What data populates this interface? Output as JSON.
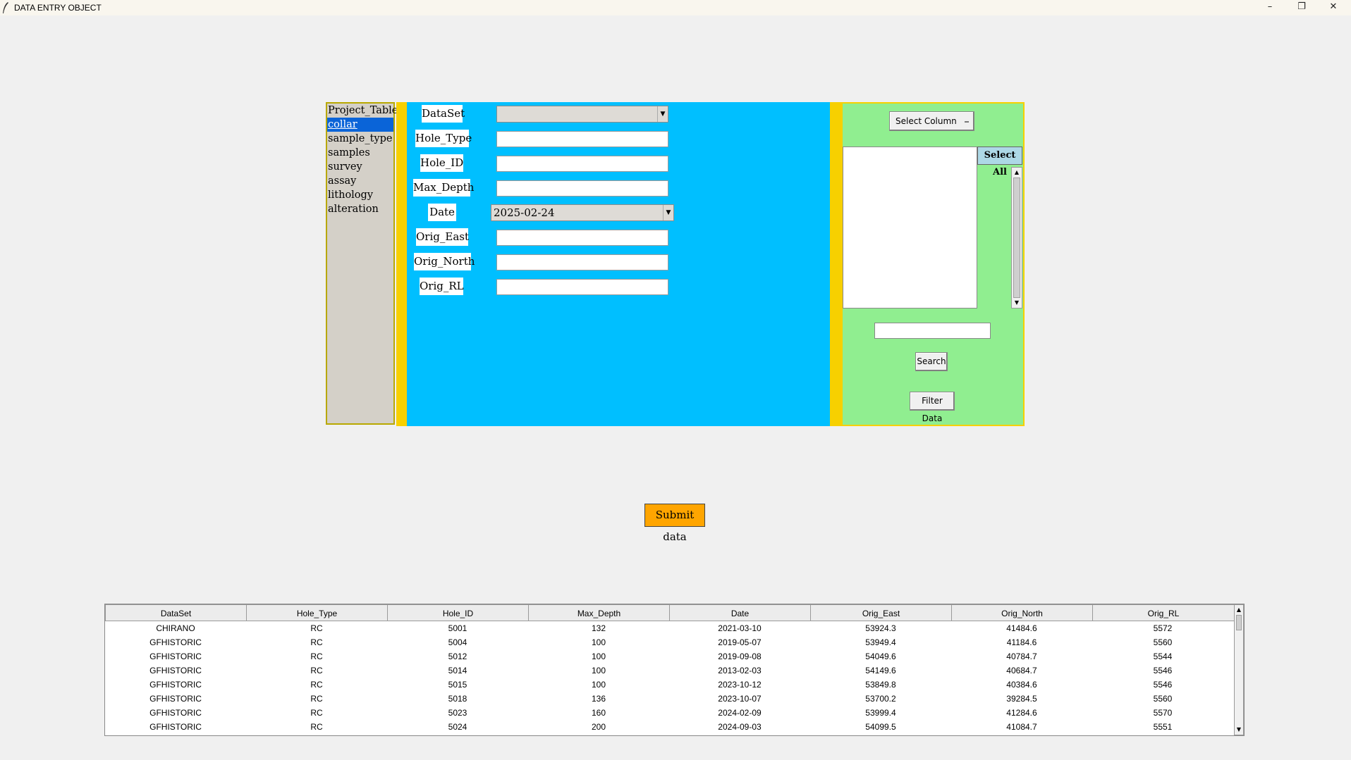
{
  "window": {
    "title": "DATA ENTRY OBJECT",
    "minimize": "–",
    "restore": "❐",
    "close": "✕"
  },
  "tables_list": {
    "items": [
      "Project_Table",
      "collar",
      "sample_type",
      "samples",
      "survey",
      "assay",
      "lithology",
      "alteration"
    ],
    "selected": "collar"
  },
  "form": {
    "fields": [
      {
        "label": "DataSet",
        "value": ""
      },
      {
        "label": "Hole_Type",
        "value": ""
      },
      {
        "label": "Hole_ID",
        "value": ""
      },
      {
        "label": "Max_Depth",
        "value": ""
      },
      {
        "label": "Date",
        "value": "2025-02-24"
      },
      {
        "label": "Orig_East",
        "value": ""
      },
      {
        "label": "Orig_North",
        "value": ""
      },
      {
        "label": "Orig_RL",
        "value": ""
      }
    ],
    "dropdown_arrow": "▼"
  },
  "filter": {
    "select_column": "Select Column",
    "select_column_indicator": "⎯",
    "select_all": "Select All",
    "search_value": "",
    "search": "Search",
    "filter_data": "Filter Data"
  },
  "submit_label": "Submit data",
  "scroll_arrows": {
    "up": "▲",
    "down": "▼"
  },
  "table": {
    "columns": [
      "DataSet",
      "Hole_Type",
      "Hole_ID",
      "Max_Depth",
      "Date",
      "Orig_East",
      "Orig_North",
      "Orig_RL"
    ],
    "rows": [
      [
        "CHIRANO",
        "RC",
        "5001",
        "132",
        "2021-03-10",
        "53924.3",
        "41484.6",
        "5572"
      ],
      [
        "GFHISTORIC",
        "RC",
        "5004",
        "100",
        "2019-05-07",
        "53949.4",
        "41184.6",
        "5560"
      ],
      [
        "GFHISTORIC",
        "RC",
        "5012",
        "100",
        "2019-09-08",
        "54049.6",
        "40784.7",
        "5544"
      ],
      [
        "GFHISTORIC",
        "RC",
        "5014",
        "100",
        "2013-02-03",
        "54149.6",
        "40684.7",
        "5546"
      ],
      [
        "GFHISTORIC",
        "RC",
        "5015",
        "100",
        "2023-10-12",
        "53849.8",
        "40384.6",
        "5546"
      ],
      [
        "GFHISTORIC",
        "RC",
        "5018",
        "136",
        "2023-10-07",
        "53700.2",
        "39284.5",
        "5560"
      ],
      [
        "GFHISTORIC",
        "RC",
        "5023",
        "160",
        "2024-02-09",
        "53999.4",
        "41284.6",
        "5570"
      ],
      [
        "GFHISTORIC",
        "RC",
        "5024",
        "200",
        "2024-09-03",
        "54099.5",
        "41084.7",
        "5551"
      ]
    ]
  }
}
